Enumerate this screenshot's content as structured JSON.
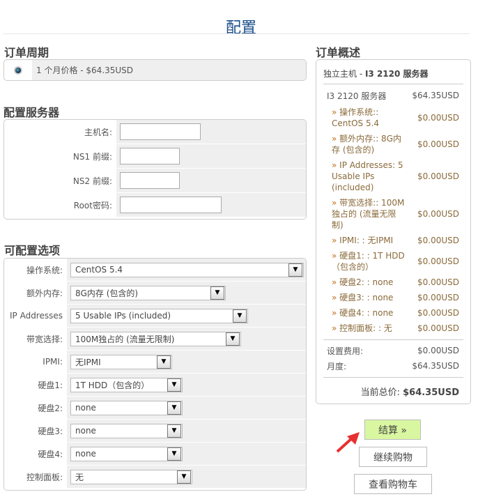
{
  "page_title": "配置",
  "billing": {
    "heading": "订单周期",
    "option": "1 个月价格 - $64.35USD"
  },
  "server": {
    "heading": "配置服务器",
    "fields": [
      {
        "label": "主机名:",
        "value": ""
      },
      {
        "label": "NS1 前缀:",
        "value": ""
      },
      {
        "label": "NS2 前缀:",
        "value": ""
      },
      {
        "label": "Root密码:",
        "value": ""
      }
    ]
  },
  "options": {
    "heading": "可配置选项",
    "items": [
      {
        "label": "操作系统:",
        "value": "CentOS 5.4"
      },
      {
        "label": "额外内存:",
        "value": "8G内存 (包含的)"
      },
      {
        "label": "IP Addresses",
        "value": "5 Usable IPs (included)"
      },
      {
        "label": "带宽选择:",
        "value": "100M独占的 (流量无限制)"
      },
      {
        "label": "IPMI:",
        "value": "无IPMI"
      },
      {
        "label": "硬盘1:",
        "value": "1T HDD（包含的）"
      },
      {
        "label": "硬盘2:",
        "value": "none"
      },
      {
        "label": "硬盘3:",
        "value": "none"
      },
      {
        "label": "硬盘4:",
        "value": "none"
      },
      {
        "label": "控制面板:",
        "value": "无"
      }
    ]
  },
  "summary": {
    "heading": "订单概述",
    "product_prefix": "独立主机 - ",
    "product_name": "I3 2120 服务器",
    "main": {
      "label": "I3 2120 服务器",
      "price": "$64.35USD"
    },
    "items": [
      {
        "label": "操作系统:: CentOS 5.4",
        "price": "$0.00USD"
      },
      {
        "label": "额外内存:: 8G内存 (包含的)",
        "price": "$0.00USD"
      },
      {
        "label": "IP Addresses: 5 Usable IPs (included)",
        "price": "$0.00USD"
      },
      {
        "label": "带宽选择:: 100M独占的 (流量无限制)",
        "price": "$0.00USD"
      },
      {
        "label": "IPMI: : 无IPMI",
        "price": "$0.00USD"
      },
      {
        "label": "硬盘1: : 1T HDD（包含的）",
        "price": "$0.00USD"
      },
      {
        "label": "硬盘2: : none",
        "price": "$0.00USD"
      },
      {
        "label": "硬盘3: : none",
        "price": "$0.00USD"
      },
      {
        "label": "硬盘4: : none",
        "price": "$0.00USD"
      },
      {
        "label": "控制面板: : 无",
        "price": "$0.00USD"
      }
    ],
    "setup_label": "设置费用:",
    "setup_price": "$0.00USD",
    "monthly_label": "月度:",
    "monthly_price": "$64.35USD",
    "total_label": "当前总价:",
    "total_price": "$64.35USD"
  },
  "buttons": {
    "checkout": "结算 »",
    "continue": "继续购物",
    "view_cart": "查看购物车"
  },
  "colors": {
    "accent": "#1a4f8a",
    "checkout_bg": "#d9f7a0",
    "arrow": "#e83030"
  }
}
